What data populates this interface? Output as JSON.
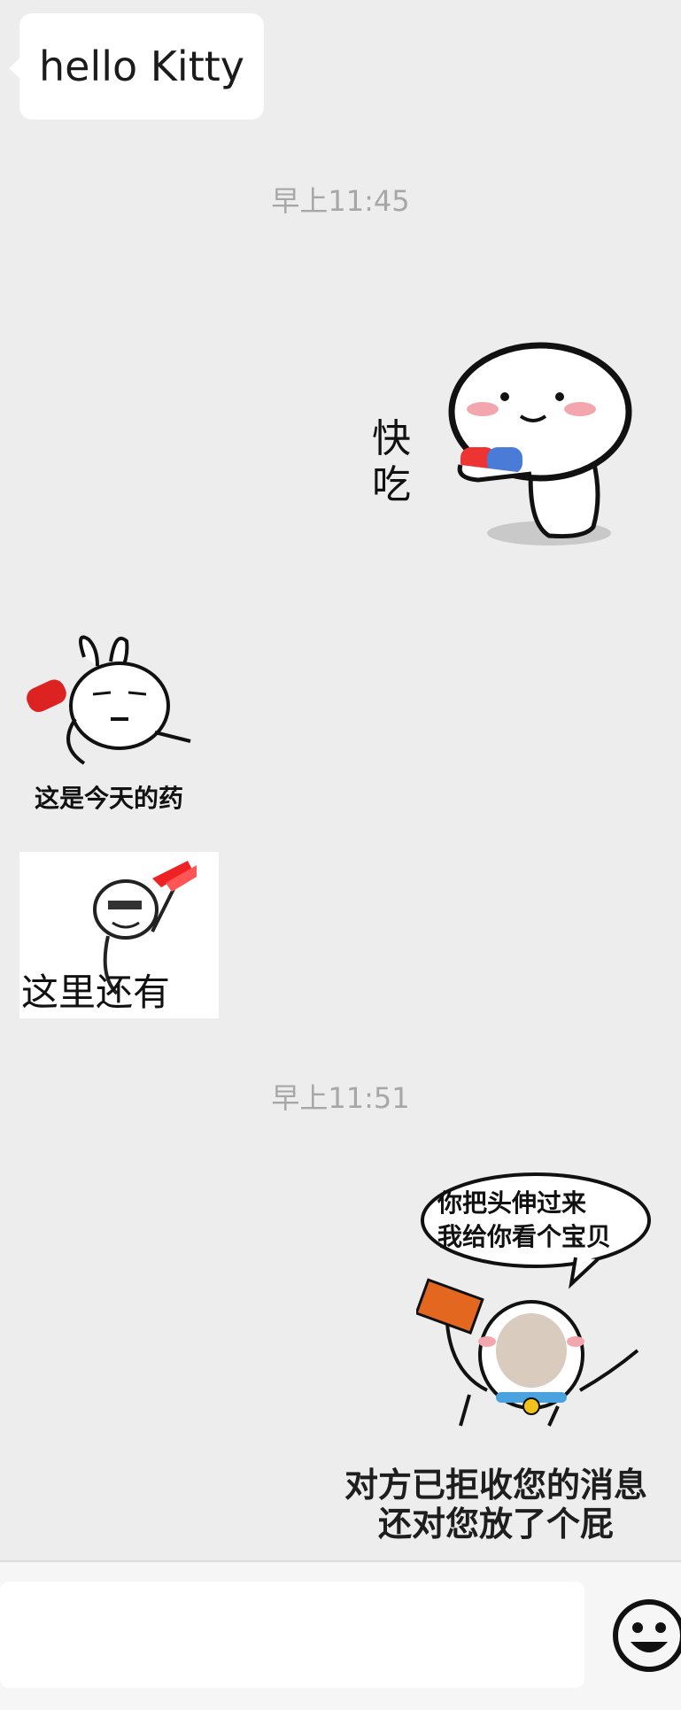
{
  "chat": {
    "messages": [
      {
        "side": "left",
        "type": "text",
        "text": "hello Kitty"
      },
      {
        "type": "time",
        "text": "早上11:45"
      },
      {
        "side": "right",
        "type": "sticker",
        "sticker": "dumpling-pill-sticker",
        "caption": "快吃"
      },
      {
        "side": "left",
        "type": "sticker",
        "sticker": "rabbit-medicine-sticker",
        "caption": "这是今天的药"
      },
      {
        "side": "left",
        "type": "sticker",
        "sticker": "more-pills-sticker",
        "caption": "这里还有"
      },
      {
        "type": "time",
        "text": "早上11:51"
      },
      {
        "side": "right",
        "type": "sticker",
        "sticker": "brick-cat-sticker",
        "caption": "你把头伸过来\n我给你看个宝贝"
      }
    ],
    "system_text": {
      "line1": "对方已拒收您的消息",
      "line2": "还对您放了个屁"
    }
  },
  "input_bar": {
    "placeholder": "",
    "emoji_icon": "smiley-face-icon"
  },
  "colors": {
    "background": "#ededed",
    "bubble": "#ffffff",
    "timestamp": "#a7a7a7"
  }
}
